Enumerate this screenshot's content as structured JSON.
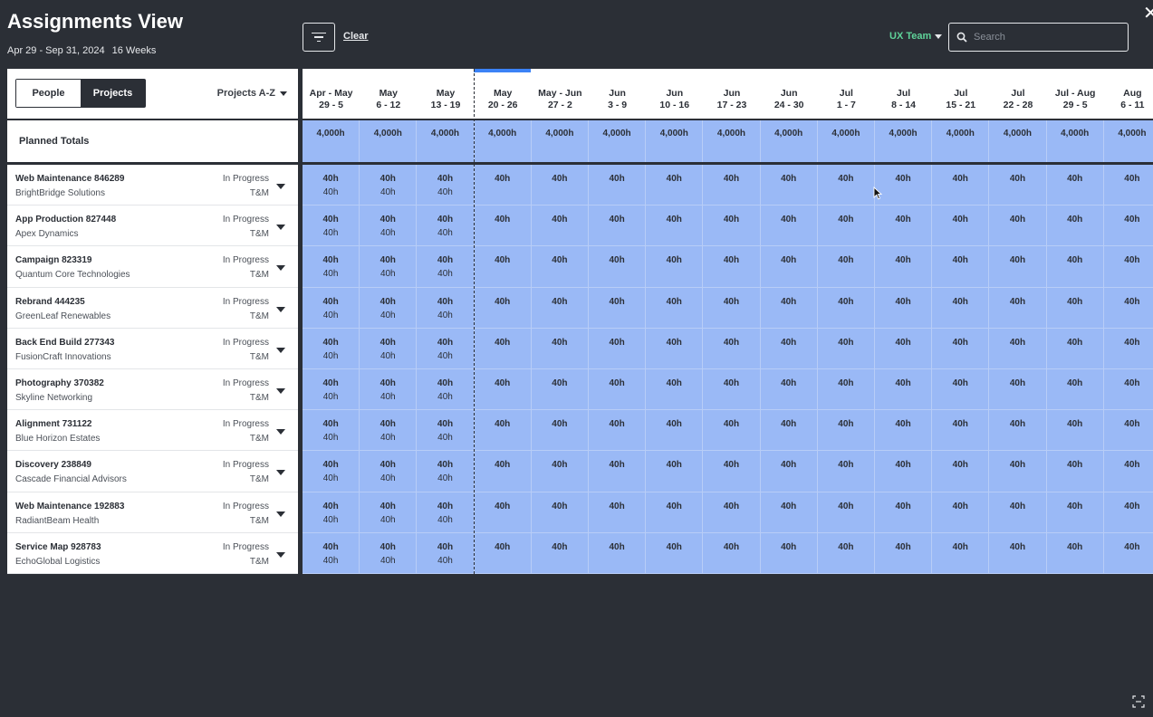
{
  "header": {
    "title": "Assignments View",
    "date_range": "Apr 29 - Sep 31, 2024",
    "weeks": "16 Weeks",
    "clear_label": "Clear",
    "team_label": "UX Team",
    "search_placeholder": "Search"
  },
  "toggle": {
    "people": "People",
    "projects": "Projects",
    "active": "Projects"
  },
  "sort_label": "Projects A-Z",
  "planned_totals_label": "Planned Totals",
  "weeks": [
    {
      "top": "Apr - May",
      "bottom": "29 - 5"
    },
    {
      "top": "May",
      "bottom": "6 - 12"
    },
    {
      "top": "May",
      "bottom": "13 - 19"
    },
    {
      "top": "May",
      "bottom": "20 - 26"
    },
    {
      "top": "May - Jun",
      "bottom": "27 - 2"
    },
    {
      "top": "Jun",
      "bottom": "3 - 9"
    },
    {
      "top": "Jun",
      "bottom": "10 - 16"
    },
    {
      "top": "Jun",
      "bottom": "17 - 23"
    },
    {
      "top": "Jun",
      "bottom": "24 - 30"
    },
    {
      "top": "Jul",
      "bottom": "1 - 7"
    },
    {
      "top": "Jul",
      "bottom": "8 - 14"
    },
    {
      "top": "Jul",
      "bottom": "15 - 21"
    },
    {
      "top": "Jul",
      "bottom": "22 - 28"
    },
    {
      "top": "Jul - Aug",
      "bottom": "29 - 5"
    },
    {
      "top": "Aug",
      "bottom": "6 - 11"
    }
  ],
  "totals": [
    "4,000h",
    "4,000h",
    "4,000h",
    "4,000h",
    "4,000h",
    "4,000h",
    "4,000h",
    "4,000h",
    "4,000h",
    "4,000h",
    "4,000h",
    "4,000h",
    "4,000h",
    "4,000h",
    "4,000h"
  ],
  "hours_value": "40h",
  "past_week_count": 3,
  "projects": [
    {
      "name": "Web Maintenance 846289",
      "client": "BrightBridge Solutions",
      "status": "In Progress",
      "billing": "T&M"
    },
    {
      "name": "App Production 827448",
      "client": "Apex Dynamics",
      "status": "In Progress",
      "billing": "T&M"
    },
    {
      "name": "Campaign 823319",
      "client": "Quantum Core Technologies",
      "status": "In Progress",
      "billing": "T&M"
    },
    {
      "name": "Rebrand 444235",
      "client": "GreenLeaf Renewables",
      "status": "In Progress",
      "billing": "T&M"
    },
    {
      "name": "Back End Build 277343",
      "client": "FusionCraft Innovations",
      "status": "In Progress",
      "billing": "T&M"
    },
    {
      "name": "Photography 370382",
      "client": "Skyline Networking",
      "status": "In Progress",
      "billing": "T&M"
    },
    {
      "name": "Alignment 731122",
      "client": "Blue Horizon Estates",
      "status": "In Progress",
      "billing": "T&M"
    },
    {
      "name": "Discovery 238849",
      "client": "Cascade Financial Advisors",
      "status": "In Progress",
      "billing": "T&M"
    },
    {
      "name": "Web Maintenance 192883",
      "client": "RadiantBeam Health",
      "status": "In Progress",
      "billing": "T&M"
    },
    {
      "name": "Service Map 928783",
      "client": "EchoGlobal Logistics",
      "status": "In Progress",
      "billing": "T&M"
    }
  ],
  "colors": {
    "background": "#2b2f36",
    "grid": "#9ab9f6",
    "accent": "#3b82f6",
    "team": "#5fd39a"
  }
}
